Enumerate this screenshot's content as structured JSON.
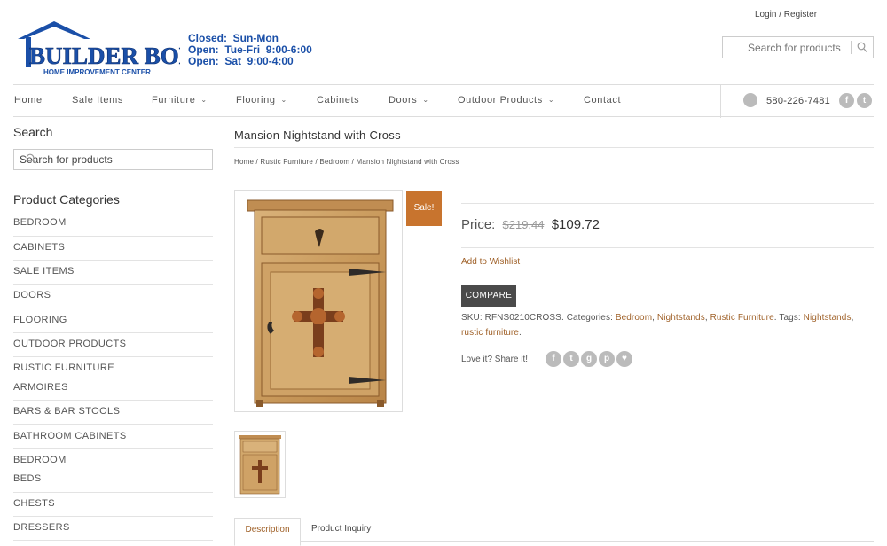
{
  "header": {
    "login": "Login / Register",
    "logo_text": "BUILDER BOB'S",
    "logo_subtext": "HOME IMPROVEMENT CENTER",
    "hours": [
      "Closed:  Sun-Mon",
      "Open:  Tue-Fri  9:00-6:00",
      "Open:  Sat  9:00-4:00"
    ],
    "search_placeholder": "Search for products"
  },
  "nav": {
    "items": [
      {
        "label": "Home",
        "dropdown": false
      },
      {
        "label": "Sale Items",
        "dropdown": false
      },
      {
        "label": "Furniture",
        "dropdown": true
      },
      {
        "label": "Flooring",
        "dropdown": true
      },
      {
        "label": "Cabinets",
        "dropdown": false
      },
      {
        "label": "Doors",
        "dropdown": true
      },
      {
        "label": "Outdoor Products",
        "dropdown": true
      },
      {
        "label": "Contact",
        "dropdown": false
      }
    ],
    "phone": "580-226-7481"
  },
  "sidebar": {
    "search_title": "Search",
    "search_placeholder": "Search for products",
    "categories_title": "Product Categories",
    "categories": [
      "BEDROOM",
      "CABINETS",
      "SALE ITEMS",
      "DOORS",
      "FLOORING",
      "OUTDOOR PRODUCTS",
      "RUSTIC FURNITURE",
      "ARMOIRES",
      "BARS & BAR STOOLS",
      "BATHROOM CABINETS",
      "BEDROOM",
      "BEDS",
      "CHESTS",
      "DRESSERS"
    ]
  },
  "product": {
    "title": "Mansion Nightstand with Cross",
    "breadcrumb": "Home / Rustic Furniture / Bedroom / Mansion Nightstand with Cross",
    "sale_badge": "Sale!",
    "price_label": "Price:",
    "old_price": "$219.44",
    "new_price": "$109.72",
    "wishlist": "Add to Wishlist",
    "compare": "COMPARE",
    "sku_prefix": "SKU: RFNS0210CROSS. Categories:",
    "categories": [
      "Bedroom",
      "Nightstands",
      "Rustic Furniture"
    ],
    "tags_prefix": "Tags:",
    "tags": [
      "Nightstands",
      "rustic furniture"
    ],
    "share_label": "Love it? Share it!"
  },
  "tabs": {
    "description": "Description",
    "inquiry": "Product Inquiry"
  },
  "colors": {
    "accent": "#a0622a",
    "sale": "#c8742e",
    "logo_blue": "#1a4fa8"
  }
}
